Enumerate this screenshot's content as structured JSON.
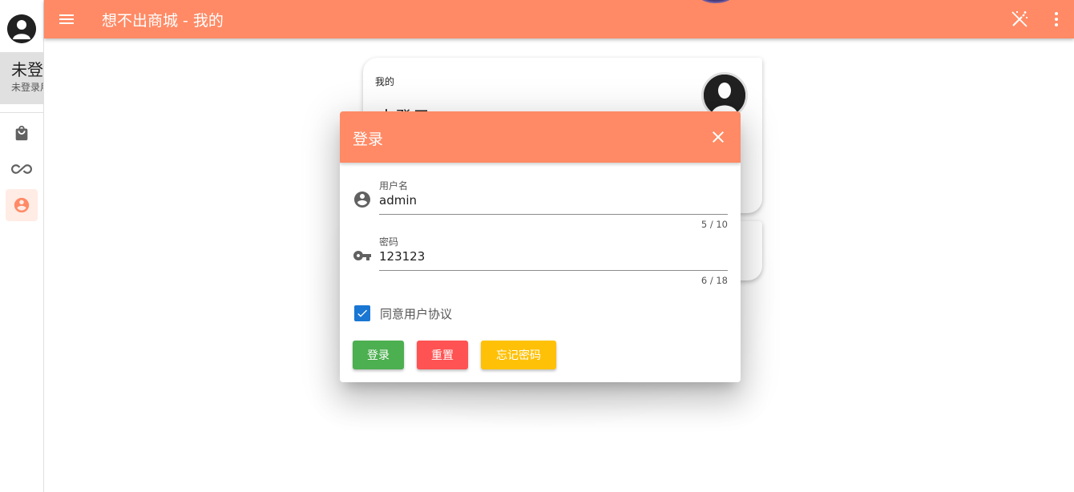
{
  "app": {
    "title": "想不出商城 - 我的",
    "accent": "#ff8a65"
  },
  "rail": {
    "user_name": "未登录",
    "user_sub": "未登录用户",
    "items": [
      {
        "icon": "shopping-bag-icon"
      },
      {
        "icon": "infinity-icon"
      },
      {
        "icon": "account-circle-icon",
        "active": true
      }
    ]
  },
  "profile_card": {
    "label": "我的",
    "name": "未登录"
  },
  "login_dialog": {
    "title": "登录",
    "username": {
      "label": "用户名",
      "value": "admin",
      "counter": "5 / 10"
    },
    "password": {
      "label": "密码",
      "value": "123123",
      "counter": "6 / 18"
    },
    "agree_label": "同意用户协议",
    "agree_checked": true,
    "buttons": {
      "login": "登录",
      "reset": "重置",
      "forgot": "忘记密码"
    },
    "button_colors": {
      "login": "#4caf50",
      "reset": "#ff5252",
      "forgot": "#ffc107"
    }
  }
}
